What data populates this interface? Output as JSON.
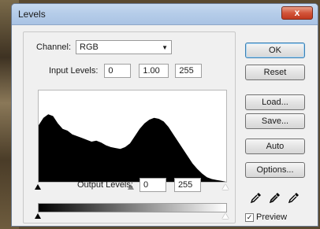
{
  "window": {
    "title": "Levels",
    "close_symbol": "x"
  },
  "channel": {
    "label": "Channel:",
    "value": "RGB"
  },
  "input_levels": {
    "label": "Input Levels:",
    "black": "0",
    "gamma": "1.00",
    "white": "255"
  },
  "output_levels": {
    "label": "Output Levels:",
    "black": "0",
    "white": "255"
  },
  "buttons": {
    "ok": "OK",
    "reset": "Reset",
    "load": "Load...",
    "save": "Save...",
    "auto": "Auto",
    "options": "Options..."
  },
  "preview": {
    "label": "Preview",
    "checked": true
  },
  "histogram": {
    "color": "#000000",
    "levels": [
      0.62,
      0.7,
      0.74,
      0.72,
      0.64,
      0.58,
      0.56,
      0.52,
      0.5,
      0.48,
      0.46,
      0.44,
      0.45,
      0.43,
      0.4,
      0.38,
      0.37,
      0.36,
      0.38,
      0.42,
      0.5,
      0.58,
      0.64,
      0.68,
      0.7,
      0.69,
      0.66,
      0.6,
      0.52,
      0.44,
      0.36,
      0.28,
      0.2,
      0.14,
      0.09,
      0.05,
      0.03,
      0.02,
      0.01,
      0.0
    ]
  }
}
